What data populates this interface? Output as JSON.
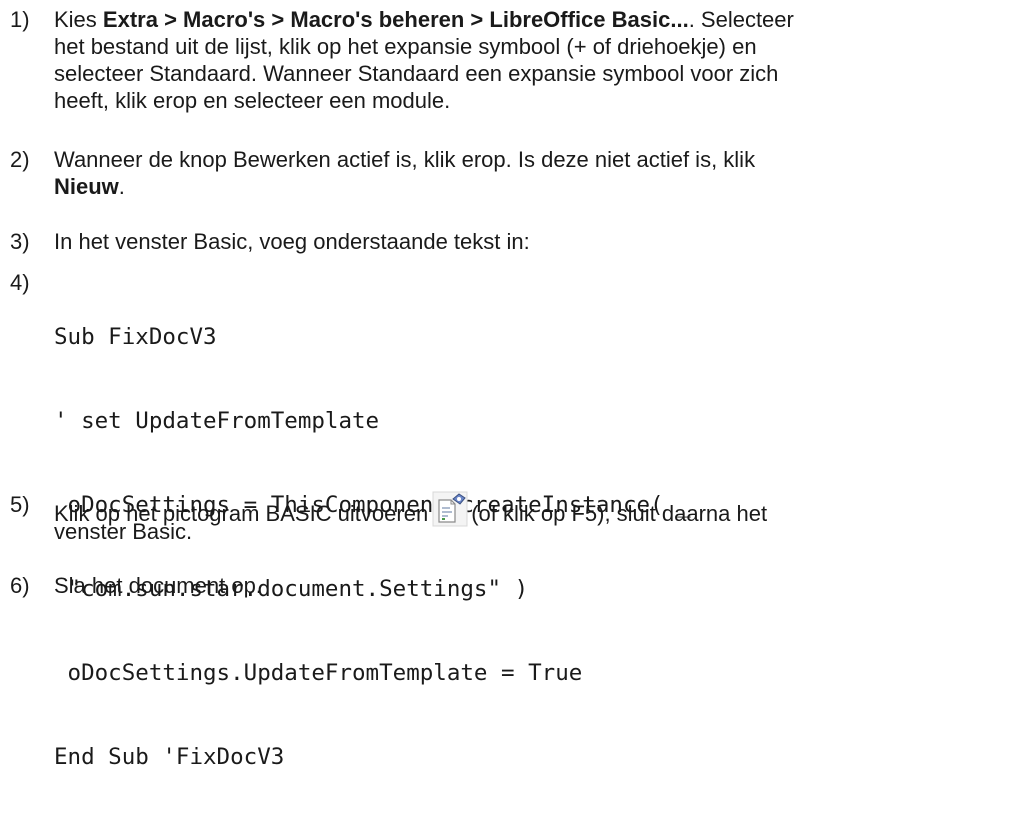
{
  "steps": [
    {
      "number": "1)",
      "lines": [
        {
          "pre": "Kies ",
          "bold": "Extra > Macro's > Macro's beheren > LibreOffice Basic...",
          "post": ". Selecteer"
        },
        {
          "text": "het bestand uit de lijst, klik op het expansie symbool (+ of driehoekje) en"
        },
        {
          "text": "selecteer Standaard. Wanneer Standaard een expansie symbool voor zich"
        },
        {
          "text": "heeft, klik erop en selecteer een module."
        }
      ]
    },
    {
      "number": "2)",
      "lines": [
        {
          "text": "Wanneer de knop Bewerken actief is, klik erop. Is deze niet actief is, klik"
        },
        {
          "bold": "Nieuw",
          "post": "."
        }
      ]
    },
    {
      "number": "3)",
      "text": "In het venster Basic, voeg onderstaande tekst in:"
    },
    {
      "number": "4)",
      "code": [
        "Sub FixDocV3",
        "' set UpdateFromTemplate",
        " oDocSettings = ThisComponent.createInstance( _",
        " \"com.sun.star.document.Settings\" )",
        " oDocSettings.UpdateFromTemplate = True",
        "End Sub 'FixDocV3"
      ]
    },
    {
      "number": "5)",
      "before_icon": "Klik op het pictogram BASIC uitvoeren",
      "icon": "basic-run-icon",
      "after_icon": "(of klik op F5), sluit daarna het",
      "line2": "venster Basic."
    },
    {
      "number": "6)",
      "text": "Sla het document op."
    }
  ]
}
